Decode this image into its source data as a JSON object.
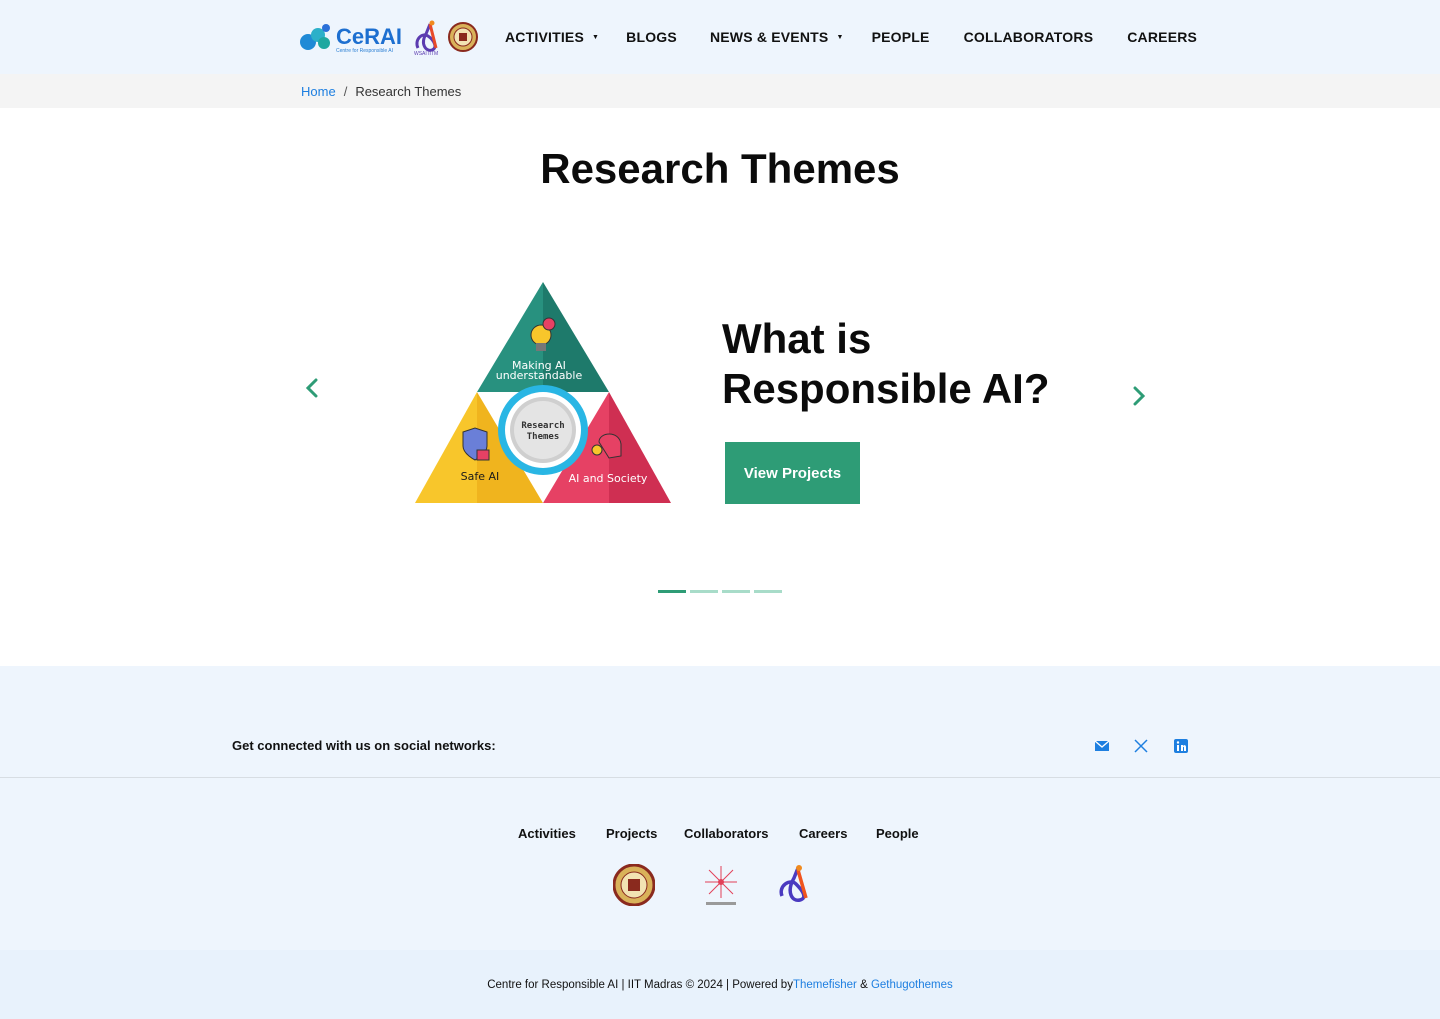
{
  "header": {
    "logo_text": "CeRAI",
    "logo_subtext": "Centre for Responsible AI",
    "nav": [
      {
        "label": "ACTIVITIES",
        "dropdown": true
      },
      {
        "label": "BLOGS",
        "dropdown": false
      },
      {
        "label": "NEWS & EVENTS",
        "dropdown": true
      },
      {
        "label": "PEOPLE",
        "dropdown": false
      },
      {
        "label": "COLLABORATORS",
        "dropdown": false
      },
      {
        "label": "CAREERS",
        "dropdown": false
      }
    ],
    "caret_glyph": "▼"
  },
  "breadcrumb": {
    "home": "Home",
    "separator": "/",
    "current": "Research Themes"
  },
  "page": {
    "title": "Research Themes"
  },
  "carousel": {
    "diagram": {
      "top_label_line1": "Making AI",
      "top_label_line2": "understandable",
      "left_label": "Safe AI",
      "right_label": "AI and Society",
      "center_line1": "Research",
      "center_line2": "Themes"
    },
    "heading_line1": "What is",
    "heading_line2": "Responsible AI?",
    "button_label": "View Projects",
    "slide_count": 4,
    "active_index": 0,
    "accent_color": "#2e9c76"
  },
  "social": {
    "label": "Get connected with us on social networks:",
    "icons": [
      "email-icon",
      "x-twitter-icon",
      "linkedin-icon"
    ]
  },
  "footer": {
    "links": [
      "Activities",
      "Projects",
      "Collaborators",
      "Careers",
      "People"
    ]
  },
  "copyright": {
    "text": "Centre for Responsible AI | IIT Madras © 2024 | Powered by ",
    "link1": "Themefisher",
    "amp": " & ",
    "link2": "Gethugothemes"
  }
}
